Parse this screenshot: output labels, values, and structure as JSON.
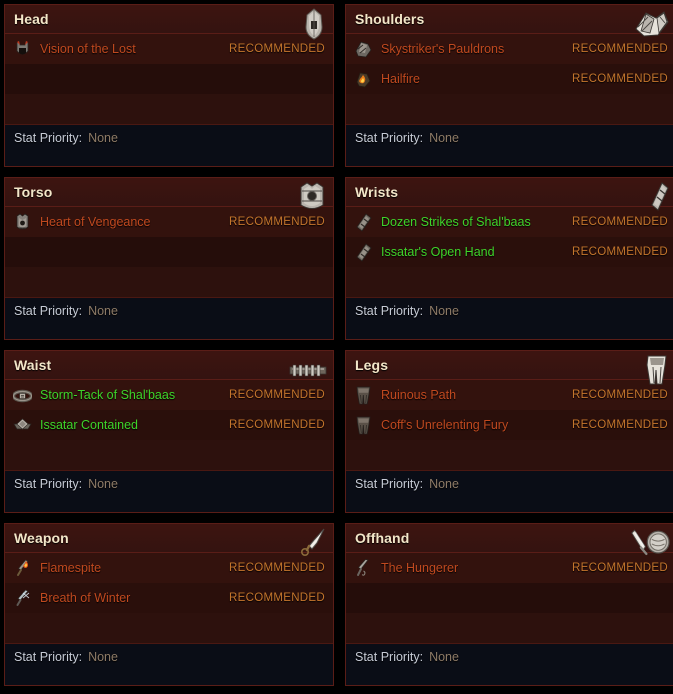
{
  "colors": {
    "legendary": "#c0491f",
    "set": "#3fd32a",
    "recommended_tag": "#c4752c",
    "panel_bg": "#2a100c",
    "panel_border": "#5a1d17",
    "header_bg": "#3d1410",
    "header_text": "#f3e6c8",
    "footer_bg": "#0a0d16",
    "stat_label": "#c6cbd6",
    "stat_value": "#8e7b67",
    "page_bg": "#000000"
  },
  "stat_priority_label": "Stat Priority:",
  "recommended_tag": "RECOMMENDED",
  "panels": [
    {
      "slot": "Head",
      "slot_icon": "helm-icon",
      "stat_priority": "None",
      "items": [
        {
          "name": "Vision of the Lost",
          "rarity": "legendary",
          "tag": "RECOMMENDED",
          "icon": "helm-item-icon"
        }
      ]
    },
    {
      "slot": "Shoulders",
      "slot_icon": "shoulders-icon",
      "stat_priority": "None",
      "items": [
        {
          "name": "Skystriker's Pauldrons",
          "rarity": "legendary",
          "tag": "RECOMMENDED",
          "icon": "pauldron-item-icon"
        },
        {
          "name": "Hailfire",
          "rarity": "legendary",
          "tag": "RECOMMENDED",
          "icon": "hailfire-item-icon"
        }
      ]
    },
    {
      "slot": "Torso",
      "slot_icon": "chest-icon",
      "stat_priority": "None",
      "items": [
        {
          "name": "Heart of Vengeance",
          "rarity": "legendary",
          "tag": "RECOMMENDED",
          "icon": "chest-item-icon"
        }
      ]
    },
    {
      "slot": "Wrists",
      "slot_icon": "bracers-icon",
      "stat_priority": "None",
      "items": [
        {
          "name": "Dozen Strikes of Shal'baas",
          "rarity": "set",
          "tag": "RECOMMENDED",
          "icon": "bracer-item-icon"
        },
        {
          "name": "Issatar's Open Hand",
          "rarity": "set",
          "tag": "RECOMMENDED",
          "icon": "bracer-item-icon"
        }
      ]
    },
    {
      "slot": "Waist",
      "slot_icon": "belt-icon",
      "stat_priority": "None",
      "items": [
        {
          "name": "Storm-Tack of Shal'baas",
          "rarity": "set",
          "tag": "RECOMMENDED",
          "icon": "belt-item-icon"
        },
        {
          "name": "Issatar Contained",
          "rarity": "set",
          "tag": "RECOMMENDED",
          "icon": "buckle-item-icon"
        }
      ]
    },
    {
      "slot": "Legs",
      "slot_icon": "legs-icon",
      "stat_priority": "None",
      "items": [
        {
          "name": "Ruinous Path",
          "rarity": "legendary",
          "tag": "RECOMMENDED",
          "icon": "pants-item-icon"
        },
        {
          "name": "Coff's Unrelenting Fury",
          "rarity": "legendary",
          "tag": "RECOMMENDED",
          "icon": "pants-item-icon"
        }
      ]
    },
    {
      "slot": "Weapon",
      "slot_icon": "dagger-icon",
      "stat_priority": "None",
      "items": [
        {
          "name": "Flamespite",
          "rarity": "legendary",
          "tag": "RECOMMENDED",
          "icon": "flame-weapon-icon"
        },
        {
          "name": "Breath of Winter",
          "rarity": "legendary",
          "tag": "RECOMMENDED",
          "icon": "frost-weapon-icon"
        }
      ]
    },
    {
      "slot": "Offhand",
      "slot_icon": "sword-shield-icon",
      "stat_priority": "None",
      "items": [
        {
          "name": "The Hungerer",
          "rarity": "legendary",
          "tag": "RECOMMENDED",
          "icon": "offhand-item-icon"
        }
      ]
    }
  ]
}
